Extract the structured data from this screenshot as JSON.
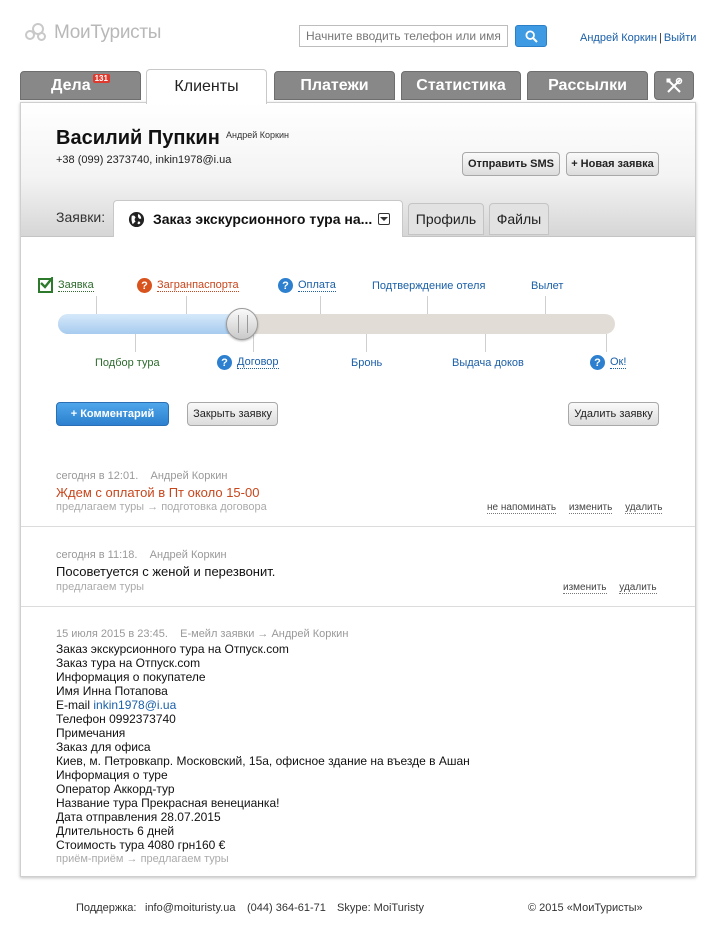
{
  "app": {
    "logo_text": "МоиТуристы",
    "search_placeholder": "Начните вводить телефон или имя",
    "user_name": "Андрей Коркин",
    "logout": "Выйти",
    "colors": {
      "accent": "#3d9ae3",
      "tab_gray": "#888888",
      "warning": "#d9531e",
      "link": "#1a5fa8"
    }
  },
  "nav": {
    "tabs": [
      {
        "label": "Дела",
        "badge": "131"
      },
      {
        "label": "Клиенты"
      },
      {
        "label": "Платежи"
      },
      {
        "label": "Статистика"
      },
      {
        "label": "Рассылки"
      }
    ],
    "tools_icon": "tools-icon"
  },
  "client": {
    "name": "Василий Пупкин",
    "owner": "Андрей Коркин",
    "contact": "+38 (099) 2373740, inkin1978@i.ua",
    "send_sms": "Отправить SMS",
    "new_request": "+ Новая заявка"
  },
  "request": {
    "label": "Заявки:",
    "current": "Заказ экскурсионного тура на...",
    "profile_tab": "Профиль",
    "files_tab": "Файлы"
  },
  "progress": {
    "value_fraction": 0.33,
    "top_stages": [
      {
        "label": "Заявка",
        "status": "done"
      },
      {
        "label": "Загранпаспорта",
        "status": "warning"
      },
      {
        "label": "Оплата",
        "status": "info"
      },
      {
        "label": "Подтверждение отеля",
        "status": "pending"
      },
      {
        "label": "Вылет",
        "status": "pending"
      }
    ],
    "bottom_stages": [
      {
        "label": "Подбор тура",
        "status": "done"
      },
      {
        "label": "Договор",
        "status": "info"
      },
      {
        "label": "Бронь",
        "status": "pending"
      },
      {
        "label": "Выдача доков",
        "status": "pending"
      },
      {
        "label": "Ок!",
        "status": "info"
      }
    ]
  },
  "actions": {
    "comment": "+ Комментарий",
    "close": "Закрыть заявку",
    "delete": "Удалить заявку"
  },
  "events": [
    {
      "time": "сегодня в 12:01.",
      "author": "Андрей Коркин",
      "text": "Ждем с оплатой в Пт около 15-00",
      "path": "предлагаем туры → подготовка договора",
      "actions": [
        "не напоминать",
        "изменить",
        "удалить"
      ]
    },
    {
      "time": "сегодня в 11:18.",
      "author": "Андрей Коркин",
      "text": "Посоветуется с женой и перезвонит.",
      "path": "предлагаем туры",
      "actions": [
        "изменить",
        "удалить"
      ]
    },
    {
      "time": "15 июля 2015 в 23:45.",
      "author": "Е-мейл заявки → Андрей Коркин",
      "lines": [
        "Заказ экскурсионного тура на Отпуск.com",
        "Заказ тура на Отпуск.com",
        "Информация о покупателе",
        "Имя Инна Потапова",
        "E-mail",
        "Телефон 0992373740",
        "Примечания",
        "Заказ для офиса",
        "Киев, м. Петровкапр. Московский, 15а, офисное здание на въезде в Ашан",
        "Информация о туре",
        "Оператор Аккорд-тур",
        "Название тура Прекрасная венецианка!",
        "Дата отправления 28.07.2015",
        "Длительность 6 дней",
        "Стоимость тура 4080 грн160 €"
      ],
      "email_link": "inkin1978@i.ua",
      "path": "приём-приём → предлагаем туры"
    }
  ],
  "footer": {
    "support_label": "Поддержка:",
    "email": "info@moituristy.ua",
    "phone": "(044) 364-61-71",
    "skype": "Skype: MoiTuristy",
    "copyright": "© 2015 «МоиТуристы»"
  }
}
